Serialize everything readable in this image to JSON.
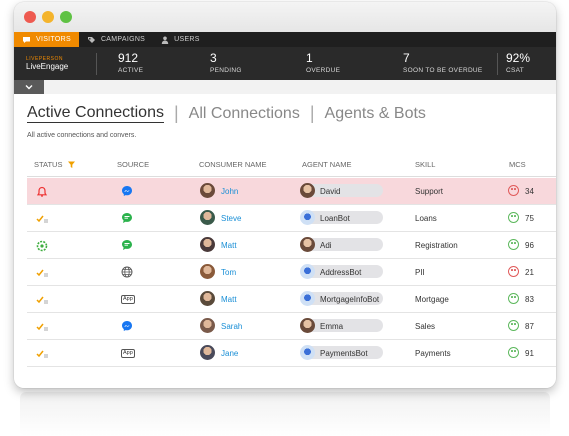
{
  "nav": {
    "tabs": [
      {
        "label": "VISITORS",
        "icon": "chat-icon"
      },
      {
        "label": "CAMPAIGNS",
        "icon": "tag-icon"
      },
      {
        "label": "USERS",
        "icon": "user-icon"
      }
    ]
  },
  "brand": {
    "line1": "LIVEPERSON",
    "line2": "LiveEngage"
  },
  "stats": [
    {
      "value": "912",
      "label": "ACTIVE"
    },
    {
      "value": "3",
      "label": "PENDING"
    },
    {
      "value": "1",
      "label": "OVERDUE"
    },
    {
      "value": "7",
      "label": "SOON TO BE OVERDUE"
    },
    {
      "value": "92%",
      "label": "CSAT"
    }
  ],
  "view_tabs": [
    "Active Connections",
    "All Connections",
    "Agents & Bots"
  ],
  "separator": "|",
  "subtitle": "All active connections and convers.",
  "columns": {
    "status": "STATUS",
    "source": "SOURCE",
    "consumer": "CONSUMER NAME",
    "agent": "AGENT NAME",
    "skill": "SKILL",
    "mcs": "MCS"
  },
  "rows": [
    {
      "status": "bell-icon",
      "source": "messenger-icon",
      "consumer": "John",
      "agent": "David",
      "agent_type": "human",
      "skill": "Support",
      "mcs_mood": "negative",
      "mcs": "34",
      "highlight": true
    },
    {
      "status": "check-lines-icon",
      "source": "sms-icon",
      "consumer": "Steve",
      "agent": "LoanBot",
      "agent_type": "bot",
      "skill": "Loans",
      "mcs_mood": "positive",
      "mcs": "75",
      "highlight": false
    },
    {
      "status": "gear-icon",
      "source": "sms-icon",
      "consumer": "Matt",
      "agent": "Adi",
      "agent_type": "human",
      "skill": "Registration",
      "mcs_mood": "positive",
      "mcs": "96",
      "highlight": false
    },
    {
      "status": "check-lines-icon",
      "source": "globe-icon",
      "consumer": "Tom",
      "agent": "AddressBot",
      "agent_type": "bot",
      "skill": "PII",
      "mcs_mood": "negative",
      "mcs": "21",
      "highlight": false
    },
    {
      "status": "check-lines-icon",
      "source": "app-icon",
      "consumer": "Matt",
      "agent": "MortgageInfoBot",
      "agent_type": "bot",
      "skill": "Mortgage",
      "mcs_mood": "positive",
      "mcs": "83",
      "highlight": false
    },
    {
      "status": "check-lines-icon",
      "source": "messenger-icon",
      "consumer": "Sarah",
      "agent": "Emma",
      "agent_type": "human",
      "skill": "Sales",
      "mcs_mood": "positive",
      "mcs": "87",
      "highlight": false
    },
    {
      "status": "check-lines-icon",
      "source": "app-icon",
      "consumer": "Jane",
      "agent": "PaymentsBot",
      "agent_type": "bot",
      "skill": "Payments",
      "mcs_mood": "positive",
      "mcs": "91",
      "highlight": false
    }
  ],
  "app_badge": "App",
  "colors": {
    "accent": "#f08a00",
    "link": "#1a8fd6",
    "positive": "#5cb85c",
    "negative": "#e05a5a",
    "alert_row": "#f8d8dc"
  }
}
